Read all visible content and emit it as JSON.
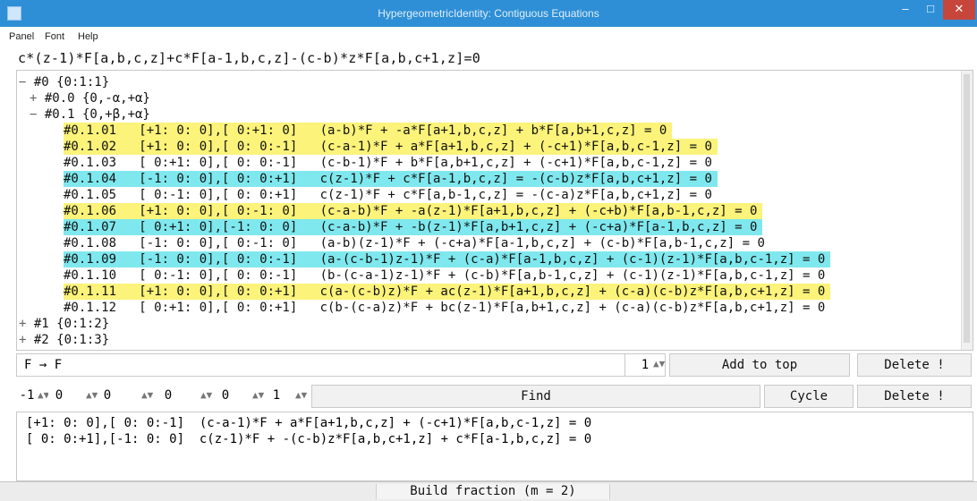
{
  "window": {
    "title": "HypergeometricIdentity: Contiguous Equations"
  },
  "menu": [
    "Panel",
    "Font",
    "Help"
  ],
  "equation": "c*(z-1)*F[a,b,c,z]+c*F[a-1,b,c,z]-(c-b)*z*F[a,b,c+1,z]=0",
  "tree": {
    "nodes": [
      "#0 {0:1:1}",
      "#0.0 {0,-α,+α}",
      "#0.1 {0,+β,+α}"
    ],
    "rows": [
      {
        "id": "#0.1.01",
        "shift": "[+1: 0: 0],[ 0:+1: 0]",
        "eq": "(a-b)*F + -a*F[a+1,b,c,z] + b*F[a,b+1,c,z] = 0",
        "highlight": "yellow"
      },
      {
        "id": "#0.1.02",
        "shift": "[+1: 0: 0],[ 0: 0:-1]",
        "eq": "(c-a-1)*F + a*F[a+1,b,c,z] + (-c+1)*F[a,b,c-1,z] = 0",
        "highlight": "yellow"
      },
      {
        "id": "#0.1.03",
        "shift": "[ 0:+1: 0],[ 0: 0:-1]",
        "eq": "(c-b-1)*F + b*F[a,b+1,c,z] + (-c+1)*F[a,b,c-1,z] = 0",
        "highlight": ""
      },
      {
        "id": "#0.1.04",
        "shift": "[-1: 0: 0],[ 0: 0:+1]",
        "eq": "c(z-1)*F + c*F[a-1,b,c,z] = -(c-b)z*F[a,b,c+1,z] = 0",
        "highlight": "cyan"
      },
      {
        "id": "#0.1.05",
        "shift": "[ 0:-1: 0],[ 0: 0:+1]",
        "eq": "c(z-1)*F + c*F[a,b-1,c,z] = -(c-a)z*F[a,b,c+1,z] = 0",
        "highlight": ""
      },
      {
        "id": "#0.1.06",
        "shift": "[+1: 0: 0],[ 0:-1: 0]",
        "eq": "(c-a-b)*F + -a(z-1)*F[a+1,b,c,z] + (-c+b)*F[a,b-1,c,z] = 0",
        "highlight": "yellow"
      },
      {
        "id": "#0.1.07",
        "shift": "[ 0:+1: 0],[-1: 0: 0]",
        "eq": "(c-a-b)*F + -b(z-1)*F[a,b+1,c,z] + (-c+a)*F[a-1,b,c,z] = 0",
        "highlight": "cyan"
      },
      {
        "id": "#0.1.08",
        "shift": "[-1: 0: 0],[ 0:-1: 0]",
        "eq": "(a-b)(z-1)*F + (-c+a)*F[a-1,b,c,z] + (c-b)*F[a,b-1,c,z] = 0",
        "highlight": ""
      },
      {
        "id": "#0.1.09",
        "shift": "[-1: 0: 0],[ 0: 0:-1]",
        "eq": "(a-(c-b-1)z-1)*F + (c-a)*F[a-1,b,c,z] + (c-1)(z-1)*F[a,b,c-1,z] = 0",
        "highlight": "cyan"
      },
      {
        "id": "#0.1.10",
        "shift": "[ 0:-1: 0],[ 0: 0:-1]",
        "eq": "(b-(c-a-1)z-1)*F + (c-b)*F[a,b-1,c,z] + (c-1)(z-1)*F[a,b,c-1,z] = 0",
        "highlight": ""
      },
      {
        "id": "#0.1.11",
        "shift": "[+1: 0: 0],[ 0: 0:+1]",
        "eq": "c(a-(c-b)z)*F + ac(z-1)*F[a+1,b,c,z] + (c-a)(c-b)z*F[a,b,c+1,z] = 0",
        "highlight": "yellow"
      },
      {
        "id": "#0.1.12",
        "shift": "[ 0:+1: 0],[ 0: 0:+1]",
        "eq": "c(b-(c-a)z)*F + bc(z-1)*F[a,b+1,c,z] + (c-a)(c-b)z*F[a,b,c+1,z] = 0",
        "highlight": ""
      }
    ],
    "tail_nodes": [
      "#1 {0:1:2}",
      "#2 {0:1:3}"
    ]
  },
  "controls": {
    "transform": "F → F",
    "count": "1",
    "add_to_top": "Add to top",
    "delete1": "Delete !",
    "spin_values": [
      "-1",
      "0",
      "0",
      "0",
      "0",
      "1"
    ],
    "find": "Find",
    "cycle": "Cycle",
    "delete2": "Delete !"
  },
  "output": {
    "lines": [
      "[+1: 0: 0],[ 0: 0:-1]  (c-a-1)*F + a*F[a+1,b,c,z] + (-c+1)*F[a,b,c-1,z] = 0",
      "[ 0: 0:+1],[-1: 0: 0]  c(z-1)*F + -(c-b)z*F[a,b,c+1,z] + c*F[a-1,b,c,z] = 0"
    ]
  },
  "status": "Build fraction (m = 2)",
  "colors": {
    "yellow": "#fbf37a",
    "cyan": "#7fe8ee",
    "titlebar": "#2e8fd6"
  }
}
